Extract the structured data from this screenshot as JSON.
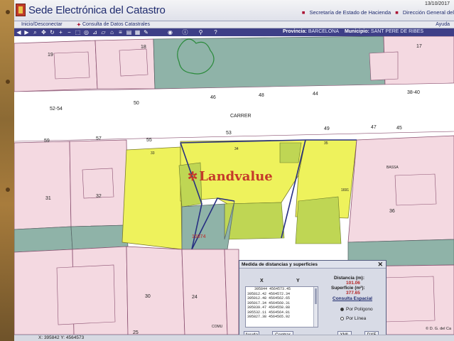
{
  "header": {
    "site_title": "Sede Electrónica del Catastro",
    "date": "13/10/2017",
    "link_1": "Secretaría de Estado de Hacienda",
    "link_2": "Dirección General del"
  },
  "nav": {
    "inicio": "Inicio/Desconectar",
    "consulta": "Consulta de Datos Catastrales",
    "ayuda": "Ayuda"
  },
  "toolbar": {
    "provincia_label": "Provincia:",
    "provincia_value": "BARCELONA",
    "municipio_label": "Municipio:",
    "municipio_value": "SANT PERE DE RIBES"
  },
  "map": {
    "street_name": "CARRER",
    "watermark": "Landvalue",
    "labels": {
      "n19": "19",
      "n18": "18",
      "n17": "17",
      "n50": "50",
      "n46": "46",
      "n48": "48",
      "n44": "44",
      "n38_40": "38-40",
      "n52_54": "52-54",
      "n59": "59",
      "n57": "57",
      "n55": "55",
      "n53": "53",
      "n49": "49",
      "n47": "47",
      "n45": "45",
      "n33": "33",
      "n34": "34",
      "n35": "35",
      "n31": "31",
      "n32": "32",
      "n36": "36",
      "n1691": "1691",
      "n24": "24",
      "n25": "25",
      "n30": "30",
      "n15874": "15874",
      "comu": "COMU",
      "bassa": "BASSA"
    }
  },
  "dialog": {
    "title": "Medida de distancias y superficies",
    "col_x": "X",
    "col_y": "Y",
    "coords": [
      "395844  4564573.45",
      "395812.42  4564572.34",
      "395012.48  4564562.65",
      "395017.34  4564560.31",
      "395039.47  4564558.88",
      "395532.11  4564564.81",
      "395827.38  4564565.92"
    ],
    "distancia_label": "Distancia (m):",
    "distancia_value": "101.06",
    "superficie_label": "Superficie (m²):",
    "superficie_value": "377.65",
    "consulta_label": "Consulta Espacial",
    "radio_poligono": "Por Polígono",
    "radio_linea": "Por Línea",
    "btn_ayuda": "Ayuda",
    "btn_centrar": "Centrar",
    "btn_xml": "XML",
    "btn_dxf": "DXF"
  },
  "status": {
    "coords": "X: 395842  Y: 4564573",
    "credit": "© D. G. del Ca"
  },
  "colors": {
    "parcel_pink": "#f4d9e1",
    "parcel_teal": "#8fb3a8",
    "highlight_yellow": "#eef25c",
    "highlight_green": "#bfd654",
    "toolbar_blue": "#3e3f87",
    "boundary_navy": "#272f82"
  }
}
